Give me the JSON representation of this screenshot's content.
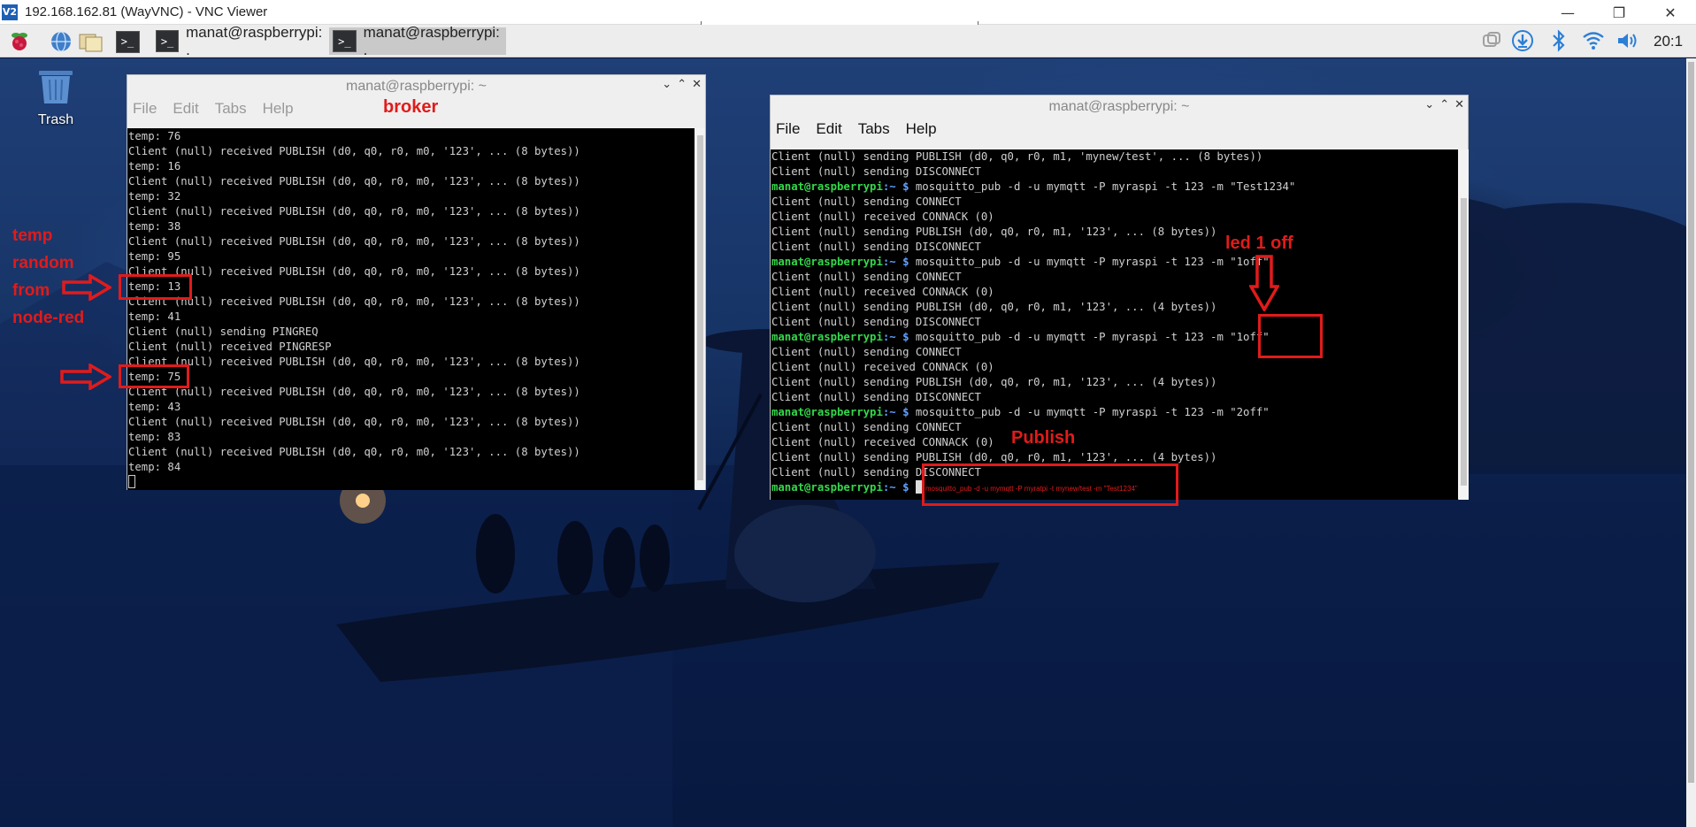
{
  "vnc": {
    "title": "192.168.162.81 (WayVNC) - VNC Viewer",
    "logo": "V2",
    "minimize": "—",
    "restore": "❐",
    "close": "✕"
  },
  "panel": {
    "tasks": [
      {
        "label": "manat@raspberrypi: .",
        "active": false
      },
      {
        "label": "manat@raspberrypi: .",
        "active": true
      }
    ],
    "clock": "20:1"
  },
  "desktop": {
    "trash_label": "Trash"
  },
  "broker_terminal": {
    "title": "manat@raspberrypi: ~",
    "menu": [
      "File",
      "Edit",
      "Tabs",
      "Help"
    ],
    "lines": [
      "temp: 76",
      "Client (null) received PUBLISH (d0, q0, r0, m0, '123', ... (8 bytes))",
      "temp: 16",
      "Client (null) received PUBLISH (d0, q0, r0, m0, '123', ... (8 bytes))",
      "temp: 32",
      "Client (null) received PUBLISH (d0, q0, r0, m0, '123', ... (8 bytes))",
      "temp: 38",
      "Client (null) received PUBLISH (d0, q0, r0, m0, '123', ... (8 bytes))",
      "temp: 95",
      "Client (null) received PUBLISH (d0, q0, r0, m0, '123', ... (8 bytes))",
      "temp: 13",
      "Client (null) received PUBLISH (d0, q0, r0, m0, '123', ... (8 bytes))",
      "temp: 41",
      "Client (null) sending PINGREQ",
      "Client (null) received PINGRESP",
      "Client (null) received PUBLISH (d0, q0, r0, m0, '123', ... (8 bytes))",
      "temp: 75",
      "Client (null) received PUBLISH (d0, q0, r0, m0, '123', ... (8 bytes))",
      "temp: 43",
      "Client (null) received PUBLISH (d0, q0, r0, m0, '123', ... (8 bytes))",
      "temp: 83",
      "Client (null) received PUBLISH (d0, q0, r0, m0, '123', ... (8 bytes))",
      "temp: 84"
    ]
  },
  "publisher_terminal": {
    "title": "manat@raspberrypi: ~",
    "menu": [
      "File",
      "Edit",
      "Tabs",
      "Help"
    ],
    "prompt_user": "manat@raspberrypi",
    "prompt_path": ":~ $",
    "lines": [
      {
        "text": "Client (null) sending PUBLISH (d0, q0, r0, m1, 'mynew/test', ... (8 bytes))"
      },
      {
        "text": "Client (null) sending DISCONNECT"
      },
      {
        "cmd": " mosquitto_pub -d -u mymqtt -P myraspi -t 123 -m \"Test1234\""
      },
      {
        "text": "Client (null) sending CONNECT"
      },
      {
        "text": "Client (null) received CONNACK (0)"
      },
      {
        "text": "Client (null) sending PUBLISH (d0, q0, r0, m1, '123', ... (8 bytes))"
      },
      {
        "text": "Client (null) sending DISCONNECT"
      },
      {
        "cmd": " mosquitto_pub -d -u mymqtt -P myraspi -t 123 -m \"1off\""
      },
      {
        "text": "Client (null) sending CONNECT"
      },
      {
        "text": "Client (null) received CONNACK (0)"
      },
      {
        "text": "Client (null) sending PUBLISH (d0, q0, r0, m1, '123', ... (4 bytes))"
      },
      {
        "text": "Client (null) sending DISCONNECT"
      },
      {
        "cmd": " mosquitto_pub -d -u mymqtt -P myraspi -t 123 -m \"1off\""
      },
      {
        "text": "Client (null) sending CONNECT"
      },
      {
        "text": "Client (null) received CONNACK (0)"
      },
      {
        "text": "Client (null) sending PUBLISH (d0, q0, r0, m1, '123', ... (4 bytes))"
      },
      {
        "text": "Client (null) sending DISCONNECT"
      },
      {
        "cmd": " mosquitto_pub -d -u mymqtt -P myraspi -t 123 -m \"2off\""
      },
      {
        "text": "Client (null) sending CONNECT"
      },
      {
        "text": "Client (null) received CONNACK (0)"
      },
      {
        "text": "Client (null) sending PUBLISH (d0, q0, r0, m1, '123', ... (4 bytes))"
      },
      {
        "text": "Client (null) sending DISCONNECT"
      }
    ],
    "typed_command": "mosquitto_pub -d -u mymqtt -P myratpi -t mynew/test -m \"Test1234\""
  },
  "annotations": {
    "broker_label": "broker",
    "temp_note": [
      "temp",
      "random",
      "from",
      "node-red"
    ],
    "led_note": "led 1 off",
    "boxed_1off": "\"1off\"",
    "publish_label": "Publish",
    "boxed_temp_13": "temp: 13",
    "boxed_temp_75": "temp: 75"
  },
  "colors": {
    "annotation_red": "#e11b1b",
    "prompt_green": "#34d84b",
    "prompt_blue": "#5fa0ff"
  }
}
